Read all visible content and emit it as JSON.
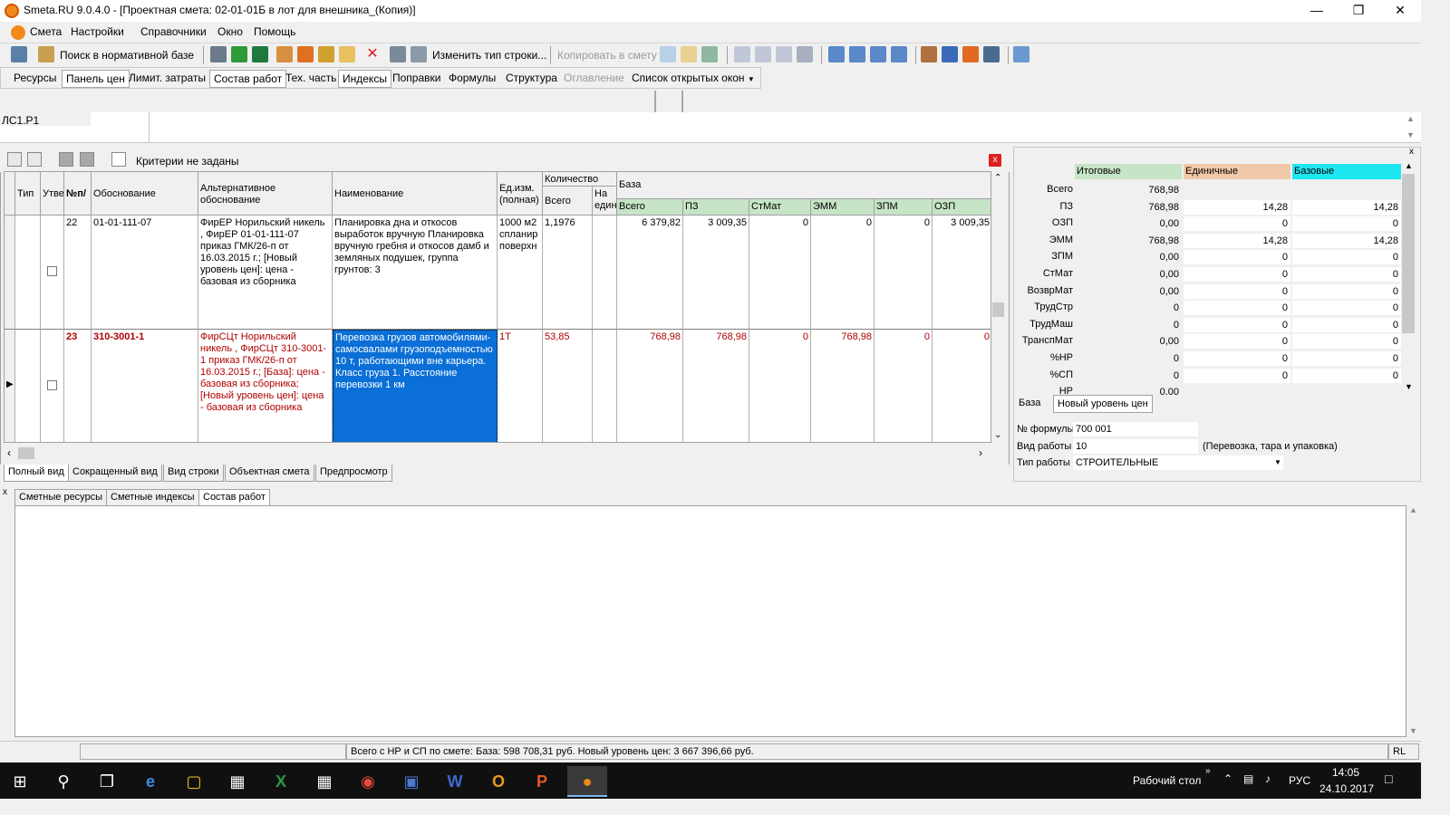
{
  "window": {
    "title": "Smeta.RU  9.0.4.0  - [Проектная смета: 02-01-01Б в лот для внешника_(Копия)]"
  },
  "menu": [
    "Смета",
    "Настройки",
    "Справочники",
    "Окно",
    "Помощь"
  ],
  "toolbar": {
    "search_label": "Поиск в нормативной базе",
    "change_row_type": "Изменить тип строки...",
    "copy_to_estimate": "Копировать в смету"
  },
  "tabs2": [
    "Ресурсы",
    "Панель цен",
    "Лимит. затраты",
    "Состав работ",
    "Тех. часть",
    "Индексы",
    "Поправки",
    "Формулы",
    "Структура",
    "Оглавление",
    "Список открытых окон"
  ],
  "path": "ЛС1.Р1",
  "filter": "Критерии не заданы",
  "grid": {
    "headers": {
      "type": "Тип",
      "approved": "Утве",
      "num": "№п/",
      "basis": "Обоснование",
      "alt_basis": "Альтернативное обоснование",
      "name": "Наименование",
      "unit": "Ед.изм. (полная)",
      "qty": "Количество",
      "qty_total": "Всего",
      "qty_per": "На един",
      "base": "База",
      "base_total": "Всего",
      "pz": "ПЗ",
      "stmat": "СтМат",
      "emm": "ЭММ",
      "zpm": "ЗПМ",
      "ozp": "ОЗП"
    },
    "rows": [
      {
        "num": "22",
        "basis": "01-01-111-07",
        "alt": "ФирЕР Норильский никель , ФирЕР 01-01-111-07 приказ ГМК/26-п  от 16.03.2015 г.; [Новый уровень цен]: цена - базовая из сборника",
        "name": "Планировка дна и откосов выработок вручную Планировка вручную гребня и откосов дамб и земляных подушек, группа грунтов: 3",
        "unit": "1000 м2 спланир поверхн",
        "qty": "1,1976",
        "qty_per": "",
        "total": "6 379,82",
        "pz": "3 009,35",
        "stmat": "0",
        "emm": "0",
        "zpm": "0",
        "ozp": "3 009,35"
      },
      {
        "num": "23",
        "basis": "310-3001-1",
        "alt": "ФирСЦт Норильский никель , ФирСЦт 310-3001-1 приказ ГМК/26-п  от 16.03.2015 г.; [База]: цена - базовая из сборника; [Новый уровень цен]: цена - базовая из сборника",
        "name": "Перевозка грузов автомобилями-самосвалами грузоподъемностью 10 т, работающими вне карьера. Класс груза 1. Расстояние перевозки 1 км",
        "unit": "1Т",
        "qty": "53,85",
        "qty_per": "",
        "total": "768,98",
        "pz": "768,98",
        "stmat": "0",
        "emm": "768,98",
        "zpm": "0",
        "ozp": "0"
      }
    ]
  },
  "view_tabs": [
    "Полный вид",
    "Сокращенный вид",
    "Вид строки",
    "Объектная смета",
    "Предпросмотр"
  ],
  "right": {
    "col_headers": [
      "Итоговые",
      "Единичные",
      "Базовые"
    ],
    "colors": {
      "itog": "#c6e4c6",
      "edin": "#f2c9a8",
      "baz": "#1ee6f0"
    },
    "rows": [
      {
        "label": "Всего",
        "itog": "768,98",
        "edin": "",
        "baz": ""
      },
      {
        "label": "ПЗ",
        "itog": "768,98",
        "edin": "14,28",
        "baz": "14,28"
      },
      {
        "label": "ОЗП",
        "itog": "0,00",
        "edin": "0",
        "baz": "0"
      },
      {
        "label": "ЭММ",
        "itog": "768,98",
        "edin": "14,28",
        "baz": "14,28"
      },
      {
        "label": "ЗПМ",
        "itog": "0,00",
        "edin": "0",
        "baz": "0"
      },
      {
        "label": "СтМат",
        "itog": "0,00",
        "edin": "0",
        "baz": "0"
      },
      {
        "label": "ВозврМат",
        "itog": "0,00",
        "edin": "0",
        "baz": "0"
      },
      {
        "label": "ТрудСтр",
        "itog": "0",
        "edin": "0",
        "baz": "0"
      },
      {
        "label": "ТрудМаш",
        "itog": "0",
        "edin": "0",
        "baz": "0"
      },
      {
        "label": "ТранспМат",
        "itog": "0,00",
        "edin": "0",
        "baz": "0"
      },
      {
        "label": "%НР",
        "itog": "0",
        "edin": "0",
        "baz": "0"
      },
      {
        "label": "%СП",
        "itog": "0",
        "edin": "0",
        "baz": "0"
      },
      {
        "label": "НР",
        "itog": "0,00",
        "edin": "",
        "baz": ""
      }
    ],
    "tabs": [
      "База",
      "Новый уровень цен"
    ],
    "formula_label": "№ формулы",
    "formula_value": "700 001",
    "work_kind_label": "Вид работы",
    "work_kind_value": "10",
    "work_kind_desc": "(Перевозка, тара и упаковка)",
    "work_type_label": "Тип работы",
    "work_type_value": "СТРОИТЕЛЬНЫЕ"
  },
  "bottom_tabs": [
    "Сметные ресурсы",
    "Сметные индексы",
    "Состав работ"
  ],
  "status": {
    "text": "Всего с НР и СП по смете: База: 598 708,31 руб. Новый уровень цен: 3 667 396,66 руб.",
    "right": "RL"
  },
  "taskbar": {
    "desktop": "Рабочий стол",
    "lang": "РУС",
    "time": "14:05",
    "date": "24.10.2017"
  }
}
